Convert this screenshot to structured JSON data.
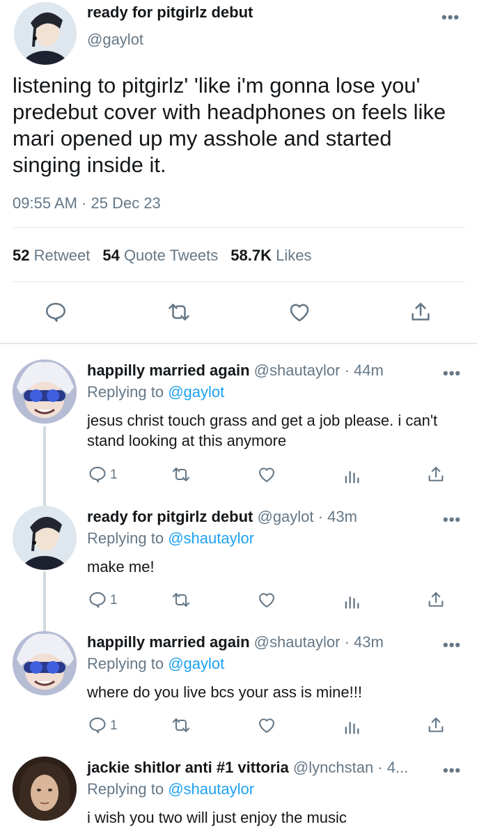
{
  "main_tweet": {
    "display_name": "ready for pitgirlz debut",
    "handle": "@gaylot",
    "text": "listening to pitgirlz' 'like i'm gonna lose you' predebut cover with headphones on feels like mari opened up my asshole and started singing inside it.",
    "timestamp": "09:55 AM · 25 Dec 23",
    "stats": {
      "retweets_count": "52",
      "retweets_label": "Retweet",
      "quote_count": "54",
      "quote_label": "Quote Tweets",
      "likes_count": "58.7K",
      "likes_label": "Likes"
    },
    "actions": [
      "reply-icon",
      "retweet-icon",
      "like-icon",
      "share-icon"
    ]
  },
  "replies": [
    {
      "display_name": "happilly married again",
      "handle": "@shautaylor",
      "time": "· 44m",
      "replying_prefix": "Replying to",
      "replying_to": "@gaylot",
      "text": "jesus christ touch grass and get a job please. i can't stand looking at this anymore",
      "reply_count": "1",
      "avatar": "gojo"
    },
    {
      "display_name": "ready for pitgirlz debut",
      "handle": "@gaylot",
      "time": "· 43m",
      "replying_prefix": "Replying to",
      "replying_to": "@shautaylor",
      "text": "make me!",
      "reply_count": "1",
      "avatar": "geto"
    },
    {
      "display_name": "happilly married again",
      "handle": "@shautaylor",
      "time": "· 43m",
      "replying_prefix": "Replying to",
      "replying_to": "@gaylot",
      "text": "where do you live bcs your ass is mine!!!",
      "reply_count": "1",
      "avatar": "gojo"
    },
    {
      "display_name": "jackie shitlor anti #1 vittoria",
      "handle": "@lynchstan",
      "time": "· 4...",
      "replying_prefix": "Replying to",
      "replying_to": "@shautaylor",
      "text": "i wish you two will just enjoy the music",
      "reply_count": "",
      "avatar": "jackie"
    }
  ],
  "more_glyph": "•••",
  "colors": {
    "text": "#14171a",
    "secondary": "#657786",
    "link": "#1da1f2",
    "divider": "#e1e8ed"
  }
}
